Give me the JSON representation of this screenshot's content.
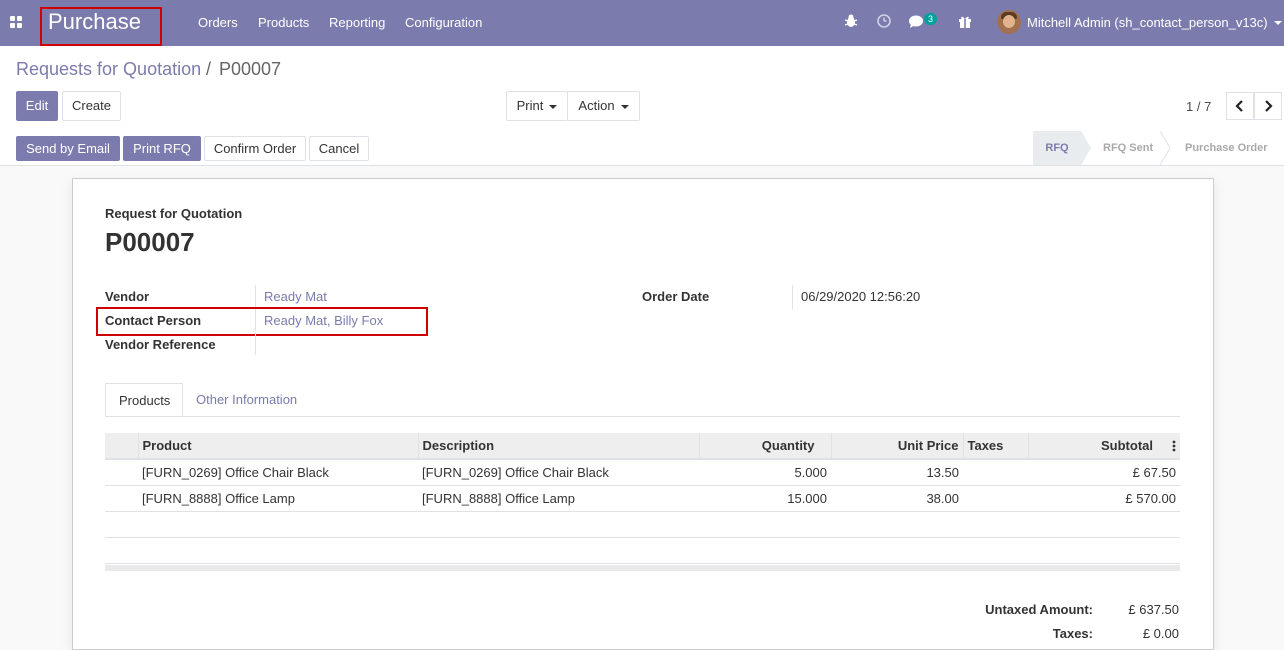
{
  "navbar": {
    "app_title": "Purchase",
    "menus": [
      "Orders",
      "Products",
      "Reporting",
      "Configuration"
    ],
    "messages_count": "3",
    "user_name": "Mitchell Admin (sh_contact_person_v13c)"
  },
  "breadcrumb": {
    "parent": "Requests for Quotation",
    "separator": "/",
    "current": "P00007"
  },
  "buttons": {
    "edit": "Edit",
    "create": "Create",
    "print": "Print",
    "action": "Action"
  },
  "pager": {
    "value": "1 / 7"
  },
  "status_buttons": {
    "send_email": "Send by Email",
    "print_rfq": "Print RFQ",
    "confirm": "Confirm Order",
    "cancel": "Cancel"
  },
  "stages": [
    "RFQ",
    "RFQ Sent",
    "Purchase Order"
  ],
  "sheet": {
    "doc_label": "Request for Quotation",
    "doc_name": "P00007",
    "vendor_label": "Vendor",
    "vendor_value": "Ready Mat",
    "contact_label": "Contact Person",
    "contact_value": "Ready Mat, Billy Fox",
    "vendor_ref_label": "Vendor Reference",
    "order_date_label": "Order Date",
    "order_date_value": "06/29/2020 12:56:20"
  },
  "tabs": [
    "Products",
    "Other Information"
  ],
  "lines": {
    "headers": [
      "Product",
      "Description",
      "Quantity",
      "Unit Price",
      "Taxes",
      "Subtotal"
    ],
    "rows": [
      {
        "product": "[FURN_0269] Office Chair Black",
        "description": "[FURN_0269] Office Chair Black",
        "quantity": "5.000",
        "unit_price": "13.50",
        "taxes": "",
        "subtotal": "£ 67.50"
      },
      {
        "product": "[FURN_8888] Office Lamp",
        "description": "[FURN_8888] Office Lamp",
        "quantity": "15.000",
        "unit_price": "38.00",
        "taxes": "",
        "subtotal": "£ 570.00"
      }
    ]
  },
  "totals": {
    "untaxed_label": "Untaxed Amount:",
    "untaxed_value": "£ 637.50",
    "taxes_label": "Taxes:",
    "taxes_value": "£ 0.00"
  },
  "colors": {
    "brand": "#7c7bad",
    "highlight": "#d00000"
  }
}
